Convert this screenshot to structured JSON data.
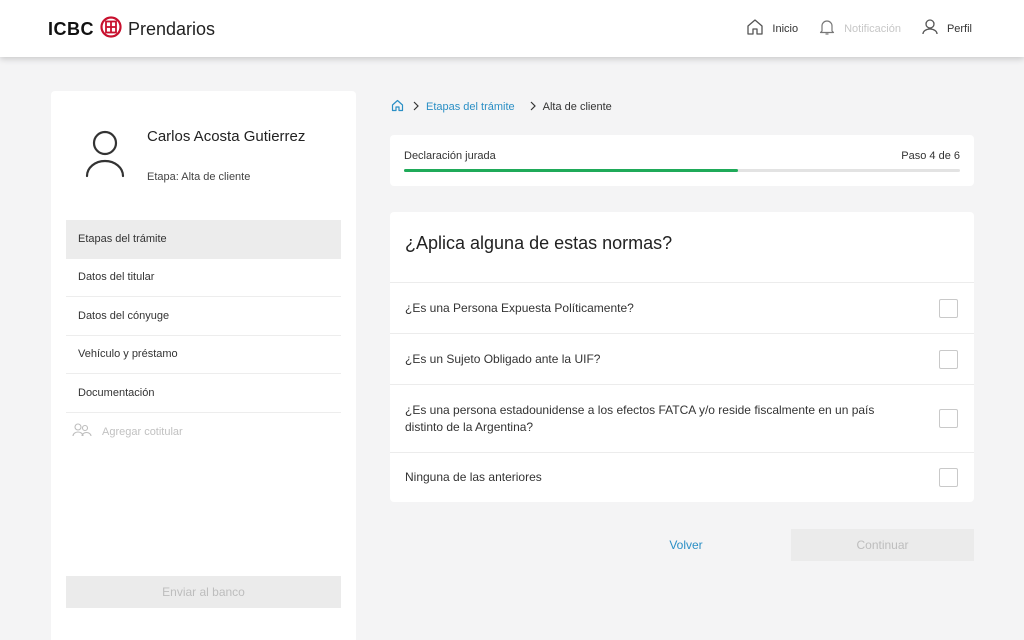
{
  "header": {
    "brand_prefix": "ICBC",
    "brand_name": "Prendarios",
    "nav": {
      "home_label": "Inicio",
      "notifications_label": "Notificación",
      "profile_label": "Perfil"
    }
  },
  "sidebar": {
    "user_name": "Carlos Acosta Gutierrez",
    "stage": "Etapa: Alta de cliente",
    "items": [
      {
        "label": "Etapas del trámite",
        "active": true
      },
      {
        "label": "Datos del titular"
      },
      {
        "label": "Datos del cónyuge"
      },
      {
        "label": "Vehículo y préstamo"
      },
      {
        "label": "Documentación"
      }
    ],
    "add_cotitular_label": "Agregar cotitular",
    "send_button_label": "Enviar al banco"
  },
  "breadcrumb": {
    "link_label": "Etapas del trámite",
    "current_label": "Alta de cliente"
  },
  "progress": {
    "label": "Declaración jurada",
    "step_text": "Paso 4 de 6",
    "fraction": 0.6
  },
  "question": {
    "title": "¿Aplica alguna de estas normas?",
    "options": [
      {
        "label": "¿Es una Persona Expuesta Políticamente?",
        "checked": false
      },
      {
        "label": "¿Es un Sujeto Obligado ante la UIF?",
        "checked": false
      },
      {
        "label": "¿Es una persona estadounidense a los efectos FATCA y/o reside fiscalmente en un país distinto de la Argentina?",
        "checked": false
      },
      {
        "label": "Ninguna de las anteriores",
        "checked": false
      }
    ]
  },
  "actions": {
    "back_label": "Volver",
    "continue_label": "Continuar"
  },
  "colors": {
    "accent": "#2b8fc5",
    "progress": "#1faa59",
    "brand_red": "#c8102e"
  }
}
